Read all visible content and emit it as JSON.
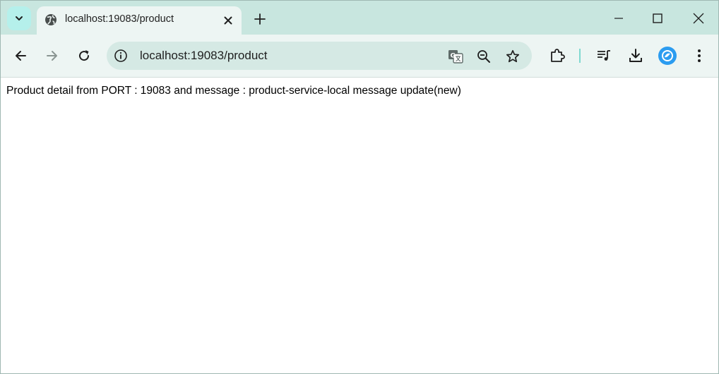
{
  "tab": {
    "title": "localhost:19083/product",
    "icon": "globe-icon"
  },
  "toolbar": {
    "url": "localhost:19083/product"
  },
  "page": {
    "message": "Product detail from PORT : 19083 and message : product-service-local message update(new)"
  },
  "colors": {
    "tabstrip": "#c8e6df",
    "toolbar": "#edf5f3",
    "omnibox": "#d5e9e4",
    "accent": "#b5f0eb"
  }
}
